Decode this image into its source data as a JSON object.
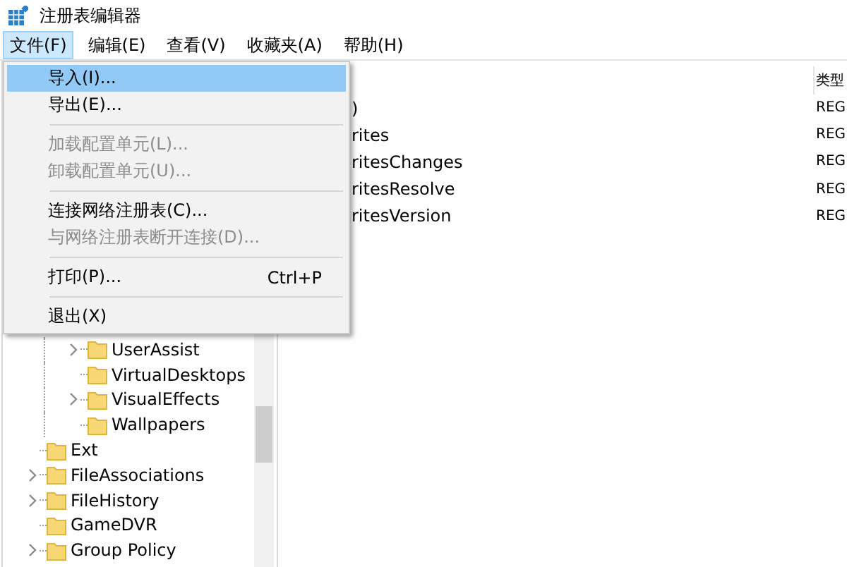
{
  "window": {
    "title": "注册表编辑器"
  },
  "menubar": [
    {
      "label": "文件(F)",
      "selected": true
    },
    {
      "label": "编辑(E)",
      "selected": false
    },
    {
      "label": "查看(V)",
      "selected": false
    },
    {
      "label": "收藏夹(A)",
      "selected": false
    },
    {
      "label": "帮助(H)",
      "selected": false
    }
  ],
  "file_menu": {
    "items": [
      {
        "kind": "item",
        "label": "导入(I)...",
        "selected": true,
        "disabled": false
      },
      {
        "kind": "item",
        "label": "导出(E)...",
        "selected": false,
        "disabled": false
      },
      {
        "kind": "separator"
      },
      {
        "kind": "item",
        "label": "加载配置单元(L)...",
        "selected": false,
        "disabled": true
      },
      {
        "kind": "item",
        "label": "卸载配置单元(U)...",
        "selected": false,
        "disabled": true
      },
      {
        "kind": "separator"
      },
      {
        "kind": "item",
        "label": "连接网络注册表(C)...",
        "selected": false,
        "disabled": false
      },
      {
        "kind": "item",
        "label": "与网络注册表断开连接(D)...",
        "selected": false,
        "disabled": true
      },
      {
        "kind": "separator"
      },
      {
        "kind": "item",
        "label": "打印(P)...",
        "shortcut": "Ctrl+P",
        "selected": false,
        "disabled": false
      },
      {
        "kind": "separator"
      },
      {
        "kind": "item",
        "label": "退出(X)",
        "selected": false,
        "disabled": false
      }
    ]
  },
  "tree": {
    "items": [
      {
        "children": [
          {
            "label": "UserAssist",
            "expandable": true
          },
          {
            "label": "VirtualDesktops",
            "expandable": false
          },
          {
            "label": "VisualEffects",
            "expandable": true
          },
          {
            "label": "Wallpapers",
            "expandable": false
          }
        ]
      },
      {
        "label": "Ext",
        "expandable": false
      },
      {
        "label": "FileAssociations",
        "expandable": true
      },
      {
        "label": "FileHistory",
        "expandable": true
      },
      {
        "label": "GameDVR",
        "expandable": false
      },
      {
        "label": "Group Policy",
        "expandable": true
      }
    ]
  },
  "values": {
    "columns": [
      "类型"
    ],
    "rows": [
      {
        "name": ")",
        "type": "REG"
      },
      {
        "name": "rites",
        "type": "REG"
      },
      {
        "name": "ritesChanges",
        "type": "REG"
      },
      {
        "name": "ritesResolve",
        "type": "REG"
      },
      {
        "name": "ritesVersion",
        "type": "REG"
      }
    ]
  }
}
